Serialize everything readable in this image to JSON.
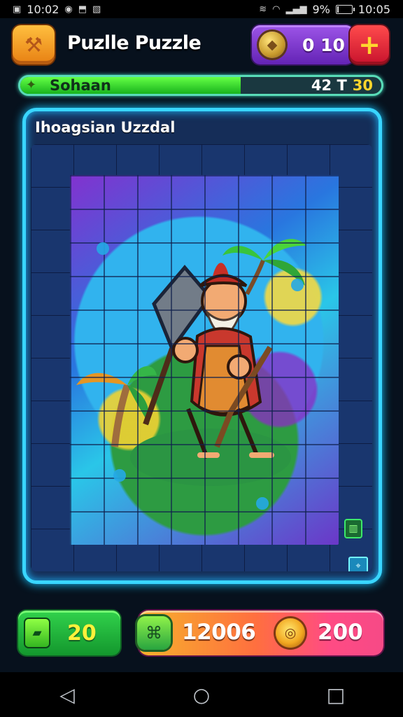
{
  "status_bar": {
    "left_text": "10:02",
    "left_icons": [
      "notification-icon",
      "nfc-icon",
      "download-icon",
      "gallery-icon"
    ],
    "right_icons": [
      "vibrate-icon",
      "wifi-icon",
      "signal-icon"
    ],
    "battery": "9%",
    "time": "10:05"
  },
  "header": {
    "title": "Puzlle Puzzle",
    "coin_value": "0 10",
    "add_button_label": "+"
  },
  "progress": {
    "label": "Sohaan",
    "count": "42 T",
    "total": "30",
    "fraction": 0.61
  },
  "board": {
    "title": "Ihoagsian Uzzdal"
  },
  "bottom": {
    "pieces_value": "20",
    "score_value": "12006",
    "gems_value": "200"
  },
  "icons": {
    "hammer": "hammer-icon",
    "coin": "coin-icon",
    "plus": "plus-icon",
    "progress": "star-icon",
    "pieces": "puzzle-piece-icon",
    "score": "badge-icon",
    "gem": "target-gem-icon",
    "map": "map-icon",
    "check": "flag-icon"
  },
  "colors": {
    "accent": "#39d6ff",
    "progress_fill": "#24c937",
    "coin_panel": "#7b34cc",
    "danger": "#e7193d"
  }
}
